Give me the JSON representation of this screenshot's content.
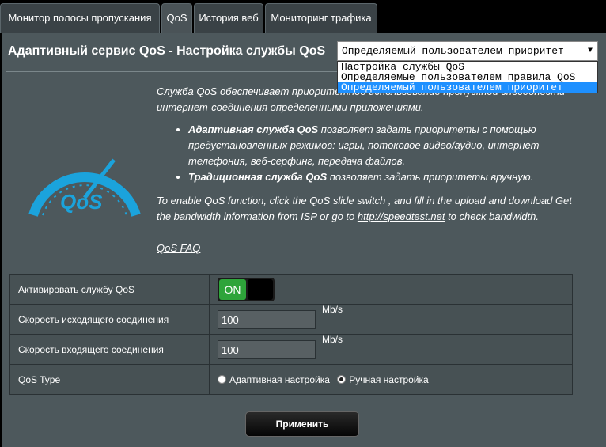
{
  "tabs": [
    {
      "label": "Монитор полосы пропускания"
    },
    {
      "label": "QoS"
    },
    {
      "label": "История веб"
    },
    {
      "label": "Мониторинг трафика"
    }
  ],
  "header": {
    "title": "Адаптивный сервис QoS - Настройка службы QoS",
    "select_value": "Определяемый пользователем приоритет",
    "select_options": [
      "Настройка службы QoS",
      "Определяемые пользователем правила QoS",
      "Определяемый пользователем приоритет"
    ]
  },
  "logo": {
    "text": "QoS",
    "color": "#1ba3dc"
  },
  "intro": {
    "text": "Служба QoS обеспечивает приоритетное использование пропускной способности интернет-соединения определенными приложениями.",
    "modes": [
      {
        "name": "Адаптивная служба QoS",
        "desc": " позволяет задать приоритеты с помощью предустановленных режимов: игры, потоковое видео/аудио, интернет-телефония, веб-серфинг, передача файлов."
      },
      {
        "name": "Традиционная служба QoS",
        "desc": " позволяет задать приоритеты вручную."
      }
    ],
    "en_before": "To enable QoS function, click the QoS slide switch , and fill in the upload and download Get the bandwidth information from ISP or go to ",
    "en_link": "http://speedtest.net",
    "en_after": " to check bandwidth.",
    "faq": "QoS FAQ"
  },
  "settings": {
    "enable_label": "Активировать службу QoS",
    "switch_on": "ON",
    "upload_label": "Скорость исходящего соединения",
    "upload_value": "100",
    "upload_unit": "Mb/s",
    "download_label": "Скорость входящего соединения",
    "download_value": "100",
    "download_unit": "Mb/s",
    "type_label": "QoS Type",
    "type_adaptive": "Адаптивная настройка",
    "type_manual": "Ручная настройка"
  },
  "apply_label": "Применить"
}
